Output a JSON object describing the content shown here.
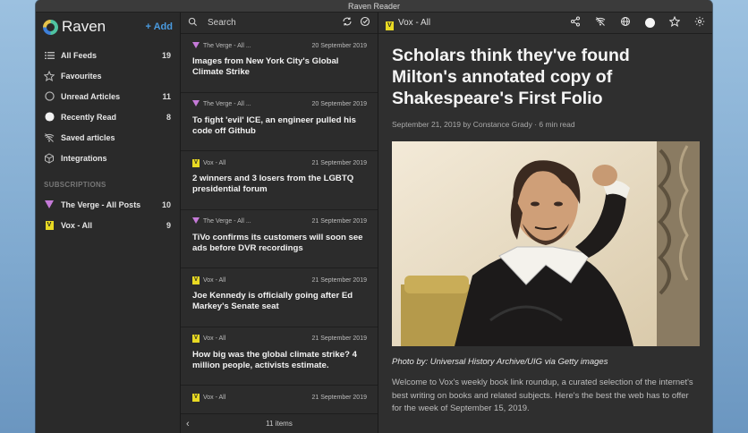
{
  "window": {
    "title": "Raven Reader"
  },
  "sidebar": {
    "brand": "Raven",
    "add_label": "+ Add",
    "items": [
      {
        "icon": "list-icon",
        "label": "All Feeds",
        "count": "19"
      },
      {
        "icon": "star-icon",
        "label": "Favourites",
        "count": ""
      },
      {
        "icon": "circle-outline-icon",
        "label": "Unread Articles",
        "count": "11"
      },
      {
        "icon": "filled-circle-icon",
        "label": "Recently Read",
        "count": "8"
      },
      {
        "icon": "wifi-off-icon",
        "label": "Saved articles",
        "count": ""
      },
      {
        "icon": "cube-icon",
        "label": "Integrations",
        "count": ""
      }
    ],
    "subscriptions_heading": "SUBSCRIPTIONS",
    "subscriptions": [
      {
        "icon": "verge-icon",
        "label": "The Verge - All Posts",
        "count": "10"
      },
      {
        "icon": "vox-icon",
        "label": "Vox - All",
        "count": "9"
      }
    ]
  },
  "list": {
    "search_placeholder": "Search",
    "articles": [
      {
        "source": "The Verge - All ...",
        "source_icon": "verge-icon",
        "date": "20 September 2019",
        "title": "Images from New York City's Global Climate Strike"
      },
      {
        "source": "The Verge - All ...",
        "source_icon": "verge-icon",
        "date": "20 September 2019",
        "title": "To fight 'evil' ICE, an engineer pulled his code off Github"
      },
      {
        "source": "Vox - All",
        "source_icon": "vox-icon",
        "date": "21 September 2019",
        "title": "2 winners and 3 losers from the LGBTQ presidential forum"
      },
      {
        "source": "The Verge - All ...",
        "source_icon": "verge-icon",
        "date": "21 September 2019",
        "title": "TiVo confirms its customers will soon see ads before DVR recordings"
      },
      {
        "source": "Vox - All",
        "source_icon": "vox-icon",
        "date": "21 September 2019",
        "title": "Joe Kennedy is officially going after Ed Markey's Senate seat"
      },
      {
        "source": "Vox - All",
        "source_icon": "vox-icon",
        "date": "21 September 2019",
        "title": "How big was the global climate strike? 4 million people, activists estimate."
      },
      {
        "source": "Vox - All",
        "source_icon": "vox-icon",
        "date": "21 September 2019",
        "title": ""
      }
    ],
    "footer_count": "11 items"
  },
  "reader": {
    "source": "Vox - All",
    "title": "Scholars think they've found Milton's annotated copy of Shakespeare's First Folio",
    "meta": "September 21, 2019 by Constance Grady · 6 min read",
    "caption": "Photo by: Universal History Archive/UIG via Getty images",
    "body": "Welcome to Vox's weekly book link roundup, a curated selection of the internet's best writing on books and related subjects. Here's the best the web has to offer for the week of September 15, 2019."
  }
}
